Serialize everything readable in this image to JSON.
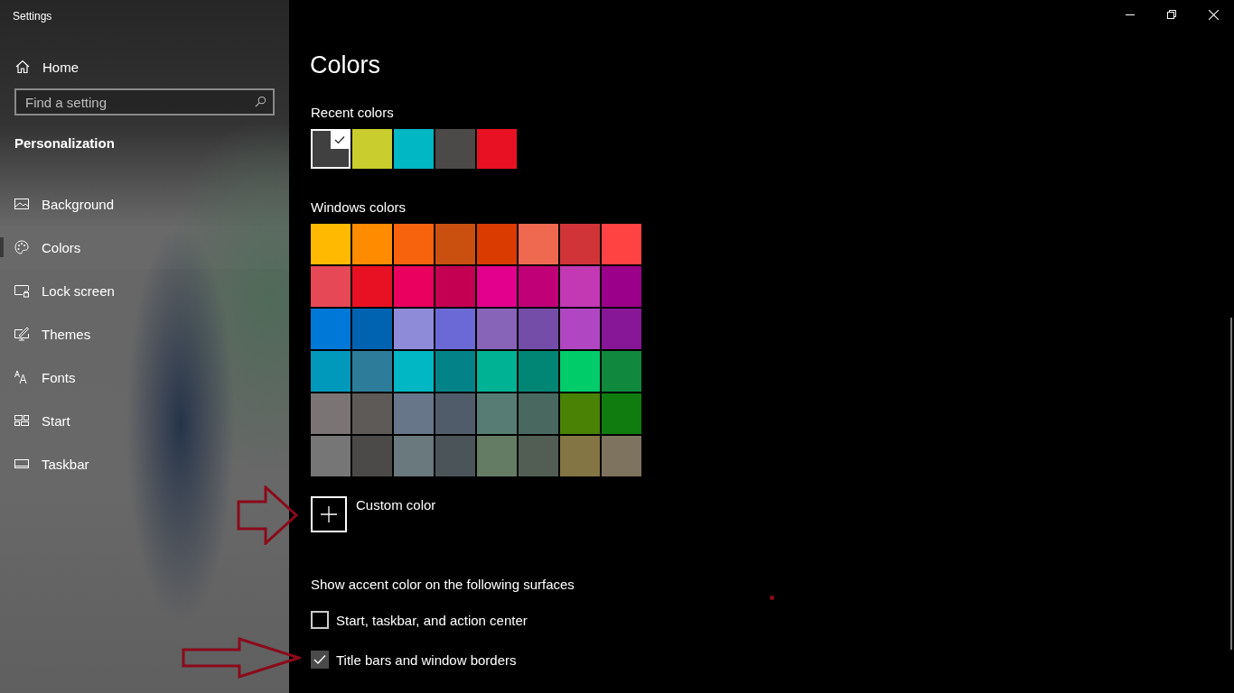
{
  "window": {
    "title": "Settings"
  },
  "sidebar": {
    "home": "Home",
    "search": {
      "placeholder": "Find a setting"
    },
    "section": "Personalization",
    "items": [
      {
        "label": "Background",
        "selected": false
      },
      {
        "label": "Colors",
        "selected": true
      },
      {
        "label": "Lock screen",
        "selected": false
      },
      {
        "label": "Themes",
        "selected": false
      },
      {
        "label": "Fonts",
        "selected": false
      },
      {
        "label": "Start",
        "selected": false
      },
      {
        "label": "Taskbar",
        "selected": false
      }
    ]
  },
  "page": {
    "title": "Colors",
    "recent_colors": {
      "label": "Recent colors",
      "swatches": [
        {
          "color": "#404040",
          "selected": true
        },
        {
          "color": "#c9cd2d",
          "selected": false
        },
        {
          "color": "#00b7c3",
          "selected": false
        },
        {
          "color": "#4c4a48",
          "selected": false
        },
        {
          "color": "#e81123",
          "selected": false
        }
      ]
    },
    "windows_colors": {
      "label": "Windows colors",
      "swatches": [
        {
          "color": "#ffb900",
          "selected": false
        },
        {
          "color": "#ff8c00",
          "selected": false
        },
        {
          "color": "#f7630c",
          "selected": false
        },
        {
          "color": "#ca5010",
          "selected": false
        },
        {
          "color": "#da3b01",
          "selected": false
        },
        {
          "color": "#ef6950",
          "selected": false
        },
        {
          "color": "#d13438",
          "selected": false
        },
        {
          "color": "#ff4343",
          "selected": false
        },
        {
          "color": "#e74856",
          "selected": false
        },
        {
          "color": "#e81123",
          "selected": false
        },
        {
          "color": "#ea005e",
          "selected": false
        },
        {
          "color": "#c30052",
          "selected": false
        },
        {
          "color": "#e3008c",
          "selected": false
        },
        {
          "color": "#bf0077",
          "selected": false
        },
        {
          "color": "#c239b3",
          "selected": false
        },
        {
          "color": "#9a0089",
          "selected": false
        },
        {
          "color": "#0078d7",
          "selected": false
        },
        {
          "color": "#0063b1",
          "selected": false
        },
        {
          "color": "#8e8cd8",
          "selected": false
        },
        {
          "color": "#6b69d6",
          "selected": false
        },
        {
          "color": "#8764b8",
          "selected": false
        },
        {
          "color": "#744da9",
          "selected": false
        },
        {
          "color": "#b146c2",
          "selected": false
        },
        {
          "color": "#881798",
          "selected": false
        },
        {
          "color": "#0099bc",
          "selected": false
        },
        {
          "color": "#2d7d9a",
          "selected": false
        },
        {
          "color": "#00b7c3",
          "selected": false
        },
        {
          "color": "#038387",
          "selected": false
        },
        {
          "color": "#00b294",
          "selected": false
        },
        {
          "color": "#018574",
          "selected": false
        },
        {
          "color": "#00cc6a",
          "selected": false
        },
        {
          "color": "#10893e",
          "selected": false
        },
        {
          "color": "#7a7574",
          "selected": false
        },
        {
          "color": "#5d5a58",
          "selected": false
        },
        {
          "color": "#68768a",
          "selected": false
        },
        {
          "color": "#515c6b",
          "selected": false
        },
        {
          "color": "#567c73",
          "selected": false
        },
        {
          "color": "#486860",
          "selected": false
        },
        {
          "color": "#498205",
          "selected": false
        },
        {
          "color": "#107c10",
          "selected": false
        },
        {
          "color": "#767676",
          "selected": false
        },
        {
          "color": "#4c4a48",
          "selected": false
        },
        {
          "color": "#69797e",
          "selected": false
        },
        {
          "color": "#4a5459",
          "selected": false
        },
        {
          "color": "#647c64",
          "selected": false
        },
        {
          "color": "#525e54",
          "selected": false
        },
        {
          "color": "#847545",
          "selected": false
        },
        {
          "color": "#7e735f",
          "selected": false
        }
      ]
    },
    "custom_color": "Custom color",
    "surfaces": {
      "label": "Show accent color on the following surfaces",
      "options": [
        {
          "label": "Start, taskbar, and action center",
          "checked": false
        },
        {
          "label": "Title bars and window borders",
          "checked": true
        }
      ]
    }
  }
}
